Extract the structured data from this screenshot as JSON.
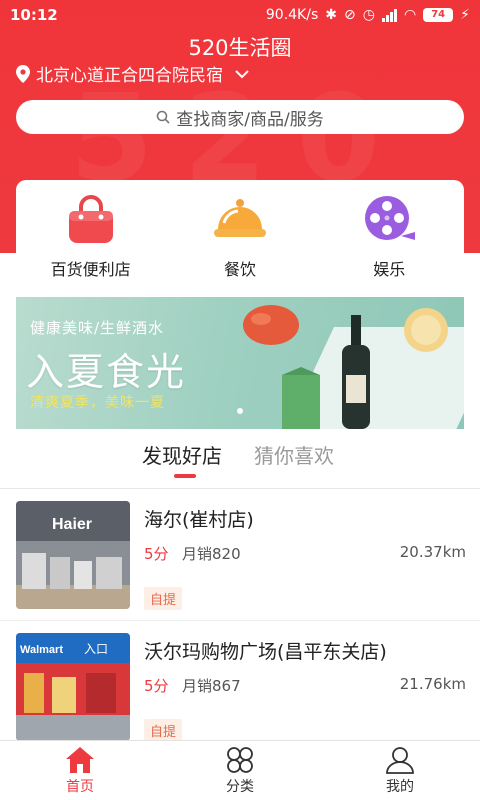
{
  "status_bar": {
    "time": "10:12",
    "network_speed": "90.4K/s",
    "battery": "74"
  },
  "header": {
    "title": "520生活圈",
    "watermark": "520",
    "location": "北京心道正合四合院民宿"
  },
  "search": {
    "placeholder": "查找商家/商品/服务"
  },
  "categories": [
    {
      "label": "百货便利店",
      "icon": "shopping-bag-icon"
    },
    {
      "label": "餐饮",
      "icon": "food-cloche-icon"
    },
    {
      "label": "娱乐",
      "icon": "film-reel-icon"
    }
  ],
  "banner": {
    "subtitle": "健康美味/生鲜酒水",
    "title": "入夏食光",
    "tagline": "清爽夏季，美味一夏"
  },
  "tabs": [
    {
      "label": "发现好店",
      "active": true
    },
    {
      "label": "猜你喜欢",
      "active": false
    }
  ],
  "stores": [
    {
      "name": "海尔(崔村店)",
      "rating": "5分",
      "sales": "月销820",
      "distance": "20.37km",
      "tag": "自提",
      "image_sign": "Haier"
    },
    {
      "name": "沃尔玛购物广场(昌平东关店)",
      "rating": "5分",
      "sales": "月销867",
      "distance": "21.76km",
      "tag": "自提",
      "image_sign": "Walmart",
      "image_sign_2": "入口"
    }
  ],
  "tabbar": [
    {
      "label": "首页",
      "icon": "home-icon",
      "active": true
    },
    {
      "label": "分类",
      "icon": "category-icon",
      "active": false
    },
    {
      "label": "我的",
      "icon": "profile-icon",
      "active": false
    }
  ],
  "colors": {
    "primary": "#ee3a3f",
    "banner_bg": "#9fd0c1",
    "tag_text": "#e56a4a"
  }
}
